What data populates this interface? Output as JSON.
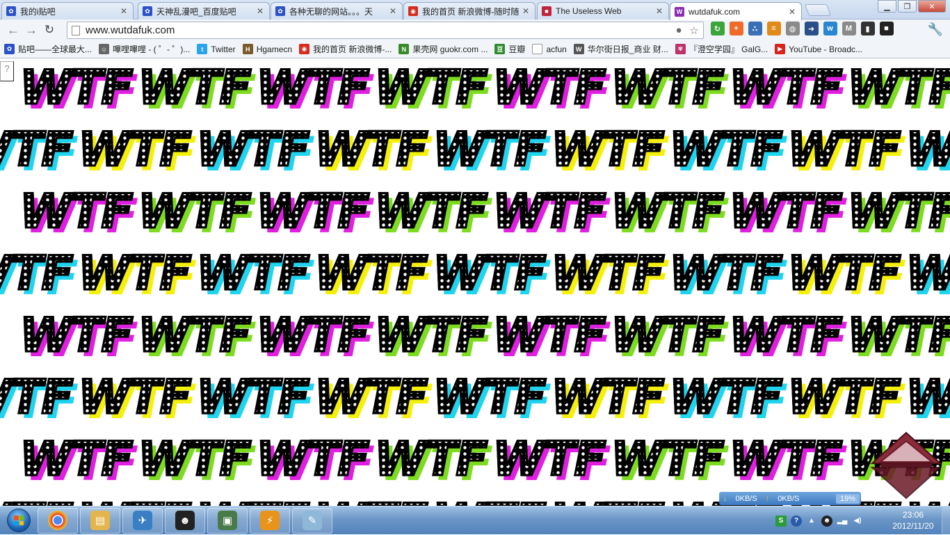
{
  "browser": {
    "tabs": [
      {
        "title": "我的i贴吧",
        "favicon": "baidu-paw-icon",
        "color": "#2b51c8",
        "active": false
      },
      {
        "title": "天神乱漫吧_百度贴吧",
        "favicon": "baidu-paw-icon",
        "color": "#2b51c8",
        "active": false
      },
      {
        "title": "各种无聊的网站。。。天",
        "favicon": "baidu-paw-icon",
        "color": "#2b51c8",
        "active": false
      },
      {
        "title": "我的首页 新浪微博-随时随",
        "favicon": "weibo-icon",
        "color": "#d52b1e",
        "active": false
      },
      {
        "title": "The Useless Web",
        "favicon": "useless-web-icon",
        "color": "#c0243b",
        "active": false
      },
      {
        "title": "wutdafuk.com",
        "favicon": "wutdafuk-icon",
        "color": "#8a2bb5",
        "active": true
      }
    ],
    "url": "www.wutdafuk.com",
    "extensions": [
      {
        "name": "green-refresh-ext-icon",
        "color": "#3aa53a",
        "glyph": "↻"
      },
      {
        "name": "orange-plus-ext-icon",
        "color": "#f06a2a",
        "glyph": "+"
      },
      {
        "name": "blue-dots-ext-icon",
        "color": "#3a6fb5",
        "glyph": "∴"
      },
      {
        "name": "rss-ext-icon",
        "color": "#e08a1a",
        "glyph": "≡"
      },
      {
        "name": "globe-ext-icon",
        "color": "#8a8a8a",
        "glyph": "◍"
      },
      {
        "name": "share-arrow-ext-icon",
        "color": "#2a4f8a",
        "glyph": "➜"
      },
      {
        "name": "weibo-ext-icon",
        "color": "#2a86d1",
        "glyph": "w"
      },
      {
        "name": "gmail-ext-icon",
        "color": "#8a8a8a",
        "glyph": "M"
      },
      {
        "name": "phone-ext-icon",
        "color": "#333333",
        "glyph": "▮"
      },
      {
        "name": "bbc-ext-icon",
        "color": "#222222",
        "glyph": "■"
      }
    ]
  },
  "bookmarks": [
    {
      "label": "贴吧——全球最大...",
      "icon": "baidu-paw-icon",
      "color": "#2b51c8"
    },
    {
      "label": "嗶哩嗶哩 - ( ゜- ゜)...",
      "icon": "bilibili-icon",
      "color": "#666666"
    },
    {
      "label": "Twitter",
      "icon": "twitter-bird-icon",
      "color": "#2aa3ef"
    },
    {
      "label": "Hgamecn",
      "icon": "hgamecn-icon",
      "color": "#7a5a2a"
    },
    {
      "label": "我的首页 新浪微博-...",
      "icon": "weibo-icon",
      "color": "#d52b1e"
    },
    {
      "label": "果壳网 guokr.com ...",
      "icon": "guokr-icon",
      "color": "#3a8a2a"
    },
    {
      "label": "豆瓣",
      "icon": "douban-icon",
      "color": "#2e8b2e"
    },
    {
      "label": "acfun",
      "icon": "blank-page-icon",
      "color": "#ffffff"
    },
    {
      "label": "华尔街日报_商业 财...",
      "icon": "wsj-icon",
      "color": "#555555"
    },
    {
      "label": "『澄空学园』 GalG...",
      "icon": "flower-icon",
      "color": "#c0306a"
    },
    {
      "label": "YouTube - Broadc...",
      "icon": "youtube-icon",
      "color": "#d9241c"
    }
  ],
  "page": {
    "word": "WTF",
    "missing_plugin_glyph": "?"
  },
  "netmeter": {
    "down": "0KB/S",
    "up": "0KB/S",
    "cpu": "19%"
  },
  "taskbar": {
    "apps": [
      {
        "name": "chrome-icon",
        "color": "#2f8a3c",
        "glyph": "◉"
      },
      {
        "name": "explorer-folder-icon",
        "color": "#e3b54a",
        "glyph": "▤"
      },
      {
        "name": "bird-app-icon",
        "color": "#3a7fc4",
        "glyph": "✈"
      },
      {
        "name": "qq-penguin-icon",
        "color": "#222222",
        "glyph": "☻"
      },
      {
        "name": "monitor-app-icon",
        "color": "#4a7a4a",
        "glyph": "▣"
      },
      {
        "name": "thunder-icon",
        "color": "#e8941a",
        "glyph": "⚡"
      },
      {
        "name": "notepad-icon",
        "color": "#8fb8d8",
        "glyph": "✎"
      }
    ],
    "clock_time": "23:06",
    "clock_date": "2012/11/20"
  }
}
